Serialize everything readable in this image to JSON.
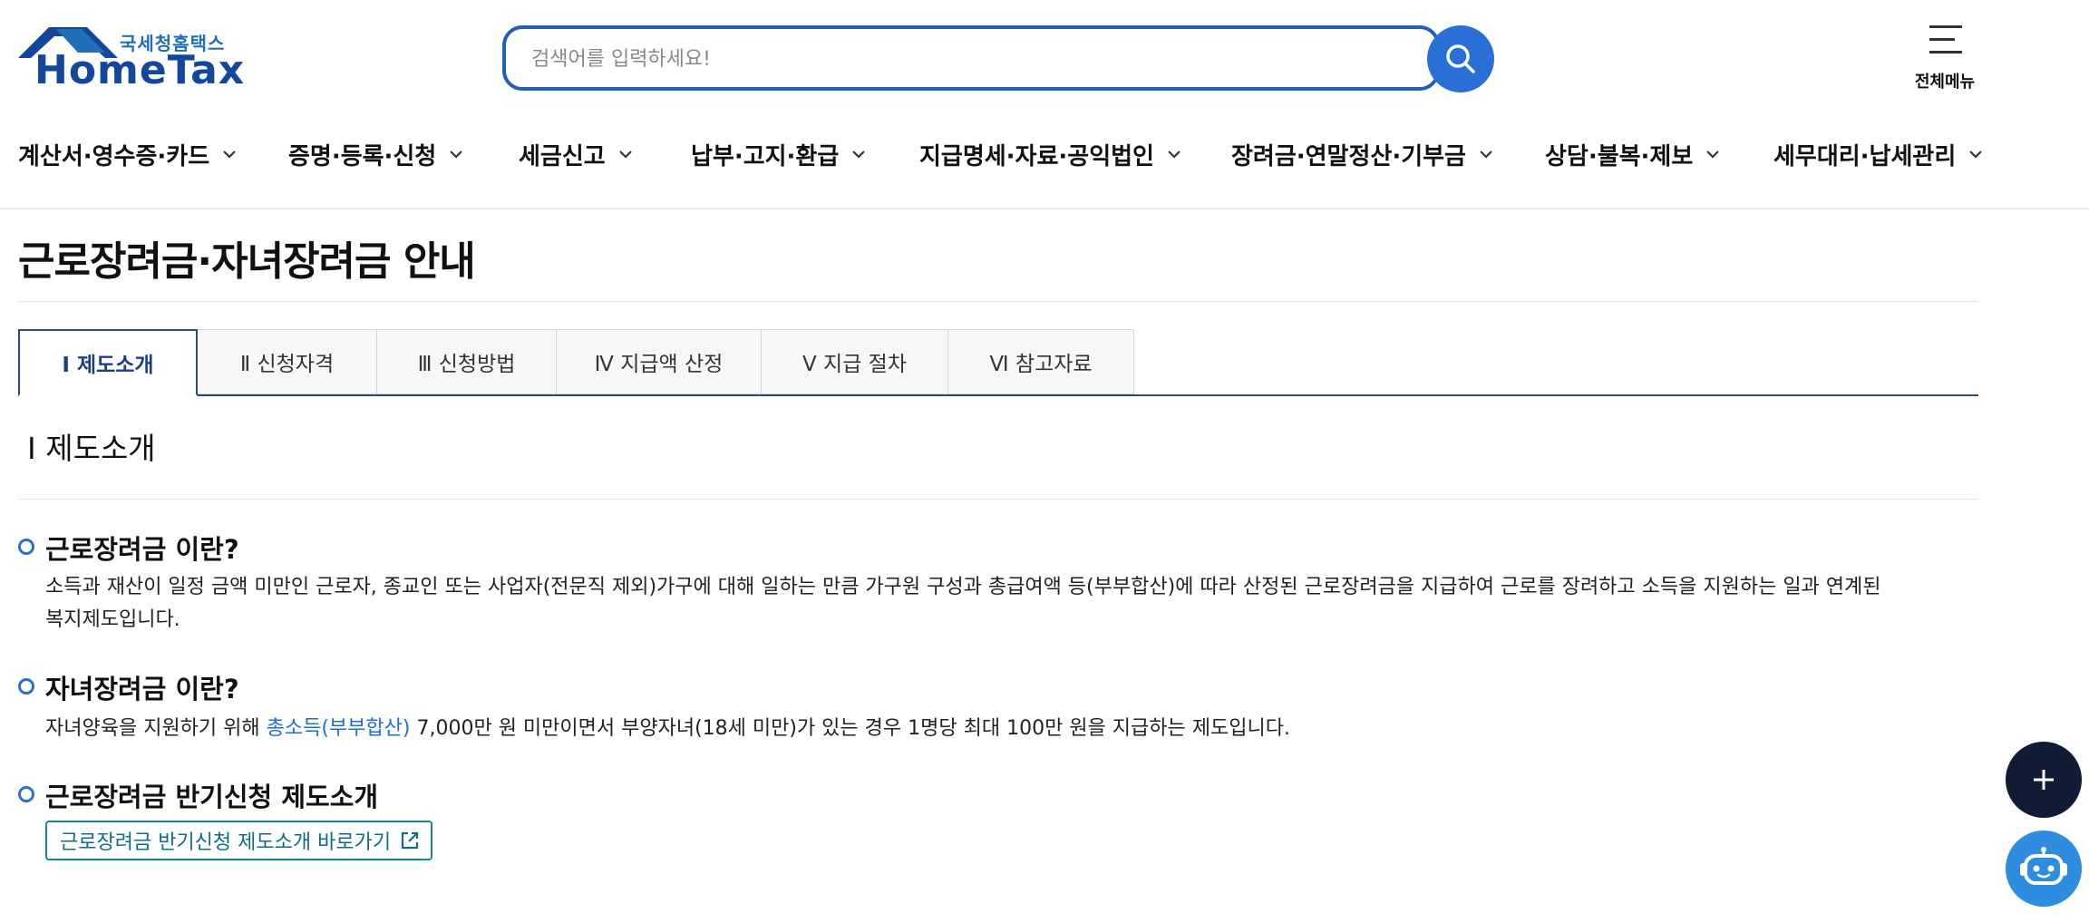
{
  "header": {
    "logo_kr": "국세청홈택스",
    "logo_en": "HomeTax",
    "search_placeholder": "검색어를 입력하세요!",
    "all_menu_label": "전체메뉴"
  },
  "gnb": {
    "items": [
      {
        "label": "계산서·영수증·카드"
      },
      {
        "label": "증명·등록·신청"
      },
      {
        "label": "세금신고"
      },
      {
        "label": "납부·고지·환급"
      },
      {
        "label": "지급명세·자료·공익법인"
      },
      {
        "label": "장려금·연말정산·기부금"
      },
      {
        "label": "상담·불복·제보"
      },
      {
        "label": "세무대리·납세관리"
      }
    ]
  },
  "page": {
    "title": "근로장려금·자녀장려금 안내"
  },
  "tabs": [
    {
      "label": "Ⅰ  제도소개",
      "active": true
    },
    {
      "label": "Ⅱ  신청자격",
      "active": false
    },
    {
      "label": "Ⅲ  신청방법",
      "active": false
    },
    {
      "label": "Ⅳ  지급액 산정",
      "active": false
    },
    {
      "label": "Ⅴ  지급 절차",
      "active": false
    },
    {
      "label": "Ⅵ   참고자료",
      "active": false
    }
  ],
  "section": {
    "title": "Ⅰ 제도소개",
    "q1": {
      "title": "근로장려금 이란?",
      "body_line1": "소득과 재산이 일정 금액 미만인 근로자, 종교인 또는 사업자(전문직 제외)가구에 대해 일하는 만큼 가구원 구성과 총급여액 등(부부합산)에 따라 산정된 근로장려금을 지급하여 근로를 장려하고 소득을 지원하는 일과 연계된",
      "body_line2": "복지제도입니다."
    },
    "q2": {
      "title": "자녀장려금 이란?",
      "body_prefix": "자녀양육을 지원하기 위해 ",
      "body_link": "총소득(부부합산)",
      "body_suffix": " 7,000만 원 미만이면서 부양자녀(18세 미만)가 있는 경우 1명당 최대 100만 원을 지급하는 제도입니다."
    },
    "q3": {
      "title": "근로장려금 반기신청 제도소개",
      "button_label": "근로장려금 반기신청 제도소개 바로가기"
    }
  },
  "colors": {
    "brand_navy": "#12479b",
    "accent_blue": "#2a6fd6",
    "tab_active": "#1b3f86",
    "link": "#1f6fd0",
    "teal": "#138a8a"
  }
}
